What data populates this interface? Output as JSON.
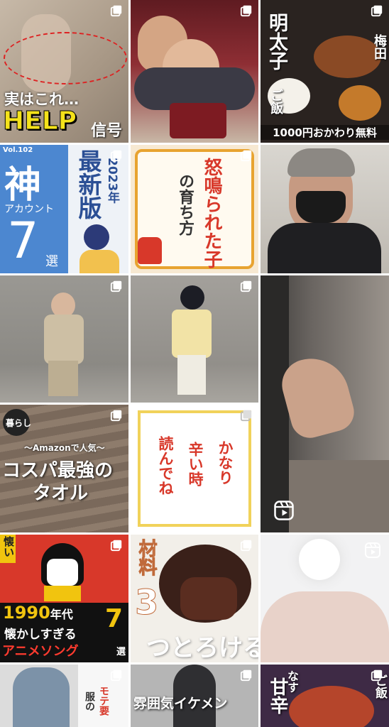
{
  "grid": {
    "tiles": [
      {
        "id": "help",
        "line1": "実はこれ…",
        "line2_a": "HELP",
        "line2_b": "信号",
        "badge": "multi-photo-icon"
      },
      {
        "id": "grandma",
        "badge": "multi-photo-icon"
      },
      {
        "id": "food",
        "v1": "明太子",
        "v2": "ご飯",
        "v3": "梅田",
        "bottom": "1000円おかわり無料",
        "badge": "multi-photo-icon"
      },
      {
        "id": "kami",
        "vol": "Vol.102",
        "kami": "神",
        "account": "アカウント",
        "num": "7",
        "sen": "選",
        "year": "2023年",
        "latest": "最新版",
        "badge": "multi-photo-icon"
      },
      {
        "id": "donarareta",
        "t1": "怒鳴られた子",
        "t2": "の育ち方",
        "badge": "multi-photo-icon"
      },
      {
        "id": "selfie"
      },
      {
        "id": "kid1",
        "badge": "multi-photo-icon"
      },
      {
        "id": "kid2",
        "badge": "multi-photo-icon"
      },
      {
        "id": "cat",
        "badge": "reels-icon"
      },
      {
        "id": "towel",
        "tag": "暮らし",
        "sub": "〜Amazonで人気〜",
        "t1": "コスパ最強の",
        "t2": "タオル",
        "badge": "multi-photo-icon"
      },
      {
        "id": "tsurai",
        "c1": "読んでね",
        "c2": "辛い時",
        "c3": "かなり",
        "badge": "multi-photo-icon"
      },
      {
        "id": "anime",
        "top": "懐い",
        "line1_a": "1990",
        "line1_b": "年代",
        "line2": "懐かしすぎる",
        "line3": "アニメソング",
        "num": "7",
        "sen": "選",
        "badge": "multi-photo-icon"
      },
      {
        "id": "choco",
        "t1": "材料",
        "num": "3",
        "t3": "つとろける",
        "badge": "multi-photo-icon"
      },
      {
        "id": "baby",
        "badge": "reels-icon"
      },
      {
        "id": "moteyou",
        "t1": "モテ要",
        "t2": "服の",
        "badge": "multi-photo-icon"
      },
      {
        "id": "ikemen",
        "t1": "雰囲気イケメン",
        "badge": "multi-photo-icon"
      },
      {
        "id": "nasu",
        "t1": "なす",
        "t2": "甘辛",
        "t3": "ご飯",
        "badge": "multi-photo-icon"
      }
    ]
  },
  "colors": {
    "accent_yellow": "#f4e21a",
    "accent_red": "#d8382a",
    "navy": "#2b4f95"
  }
}
